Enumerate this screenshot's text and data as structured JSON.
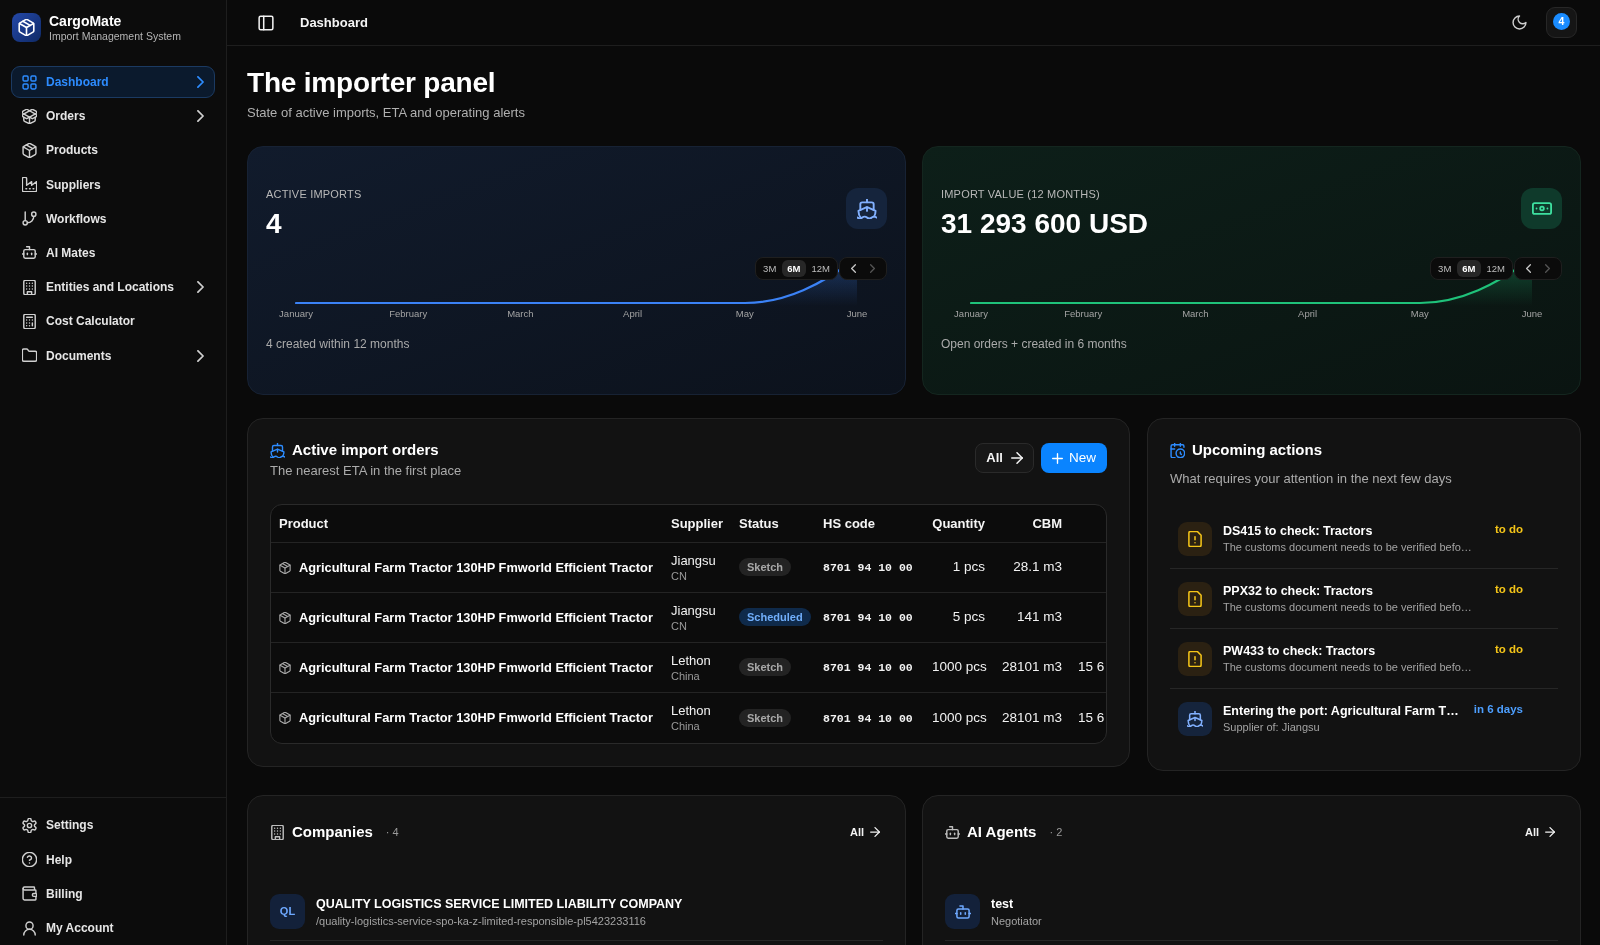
{
  "sidebar": {
    "brand": {
      "name": "CargoMate",
      "tagline": "Import Management System"
    },
    "nav": [
      {
        "label": "Dashboard",
        "selected": true,
        "expandable": true
      },
      {
        "label": "Orders",
        "selected": false,
        "expandable": true
      },
      {
        "label": "Products",
        "selected": false,
        "expandable": false
      },
      {
        "label": "Suppliers",
        "selected": false,
        "expandable": false
      },
      {
        "label": "Workflows",
        "selected": false,
        "expandable": false
      },
      {
        "label": "AI Mates",
        "selected": false,
        "expandable": false
      },
      {
        "label": "Entities and Locations",
        "selected": false,
        "expandable": true
      },
      {
        "label": "Cost Calculator",
        "selected": false,
        "expandable": false
      },
      {
        "label": "Documents",
        "selected": false,
        "expandable": true
      }
    ],
    "footer_nav": [
      {
        "label": "Settings",
        "selected": false
      },
      {
        "label": "Help",
        "selected": false
      },
      {
        "label": "Billing",
        "selected": false
      },
      {
        "label": "My Account",
        "selected": false
      }
    ]
  },
  "topbar": {
    "title": "Dashboard",
    "notification_count": "4"
  },
  "header": {
    "title": "The importer panel",
    "subtitle": "State of active imports, ETA and operating alerts"
  },
  "stats": [
    {
      "kind": "imports",
      "label": "ACTIVE IMPORTS",
      "value": "4",
      "ranges": [
        {
          "label": "3M",
          "selected": false
        },
        {
          "label": "6M",
          "selected": true
        },
        {
          "label": "12M",
          "selected": false
        }
      ],
      "next_disabled": true,
      "months": [
        "January",
        "February",
        "March",
        "April",
        "May",
        "June"
      ],
      "note": "4 created within 12 months"
    },
    {
      "kind": "value",
      "label": "IMPORT VALUE (12 MONTHS)",
      "value": "31 293 600 USD",
      "ranges": [
        {
          "label": "3M",
          "selected": false
        },
        {
          "label": "6M",
          "selected": true
        },
        {
          "label": "12M",
          "selected": false
        }
      ],
      "next_disabled": true,
      "months": [
        "January",
        "February",
        "March",
        "April",
        "May",
        "June"
      ],
      "note": "Open orders + created in 6 months"
    }
  ],
  "orders": {
    "title": "Active import orders",
    "subtitle": "The nearest ETA in the first place",
    "all_label": "All",
    "new_label": "New",
    "columns": [
      "Product",
      "Supplier",
      "Status",
      "HS code",
      "Quantity",
      "CBM"
    ],
    "rows": [
      {
        "product": "Agricultural Farm Tractor 130HP Fmworld Efficient Tractor",
        "supplier": "Jiangsu",
        "country": "CN",
        "status": {
          "label": "Sketch",
          "color": "#232323"
        },
        "hs_code": "8701 94 10 00",
        "quantity": "1 pcs",
        "cbm": "28.1 m3"
      },
      {
        "product": "Agricultural Farm Tractor 130HP Fmworld Efficient Tractor",
        "supplier": "Jiangsu",
        "country": "CN",
        "status": {
          "label": "Scheduled",
          "color": "#0f2a4a"
        },
        "hs_code": "8701 94 10 00",
        "quantity": "5 pcs",
        "cbm": "141 m3"
      },
      {
        "product": "Agricultural Farm Tractor 130HP Fmworld Efficient Tractor",
        "supplier": "Lethon",
        "country": "China",
        "status": {
          "label": "Sketch",
          "color": "#232323"
        },
        "hs_code": "8701 94 10 00",
        "quantity": "1000 pcs",
        "cbm": "28101 m3",
        "column_7": "15 6"
      },
      {
        "product": "Agricultural Farm Tractor 130HP Fmworld Efficient Tractor",
        "supplier": "Lethon",
        "country": "China",
        "status": {
          "label": "Sketch",
          "color": "#232323"
        },
        "hs_code": "8701 94 10 00",
        "quantity": "1000 pcs",
        "cbm": "28101 m3",
        "column_7": "15 6"
      }
    ]
  },
  "actions": {
    "title": "Upcoming actions",
    "subtitle": "What requires your attention in the next few days",
    "items": [
      {
        "kind": "document",
        "title": "DS415 to check: Tractors",
        "description": "The customs document needs to be verified befo…",
        "due": "to do",
        "color": "#f5c518"
      },
      {
        "kind": "document",
        "title": "PPX32 to check: Tractors",
        "description": "The customs document needs to be verified befo…",
        "due": "to do",
        "color": "#f5c518"
      },
      {
        "kind": "document",
        "title": "PW433 to check: Tractors",
        "description": "The customs document needs to be verified befo…",
        "due": "to do",
        "color": "#f5c518"
      },
      {
        "kind": "arrival",
        "title": "Entering the port: Agricultural Farm T…",
        "description": "Supplier of: Jiangsu",
        "due": "in 6 days",
        "color": "#4d9fff"
      }
    ]
  },
  "companies": {
    "title": "Companies",
    "count": "· 4",
    "all_label": "All",
    "items": [
      {
        "initials": "QL",
        "name": "QUALITY LOGISTICS SERVICE LIMITED LIABILITY COMPANY",
        "slug": "/quality-logistics-service-spo-ka-z-limited-responsible-pl5423233116"
      }
    ]
  },
  "agents": {
    "title": "AI Agents",
    "count": "· 2",
    "all_label": "All",
    "items": [
      {
        "name": "test",
        "role": "Negotiator"
      }
    ]
  }
}
